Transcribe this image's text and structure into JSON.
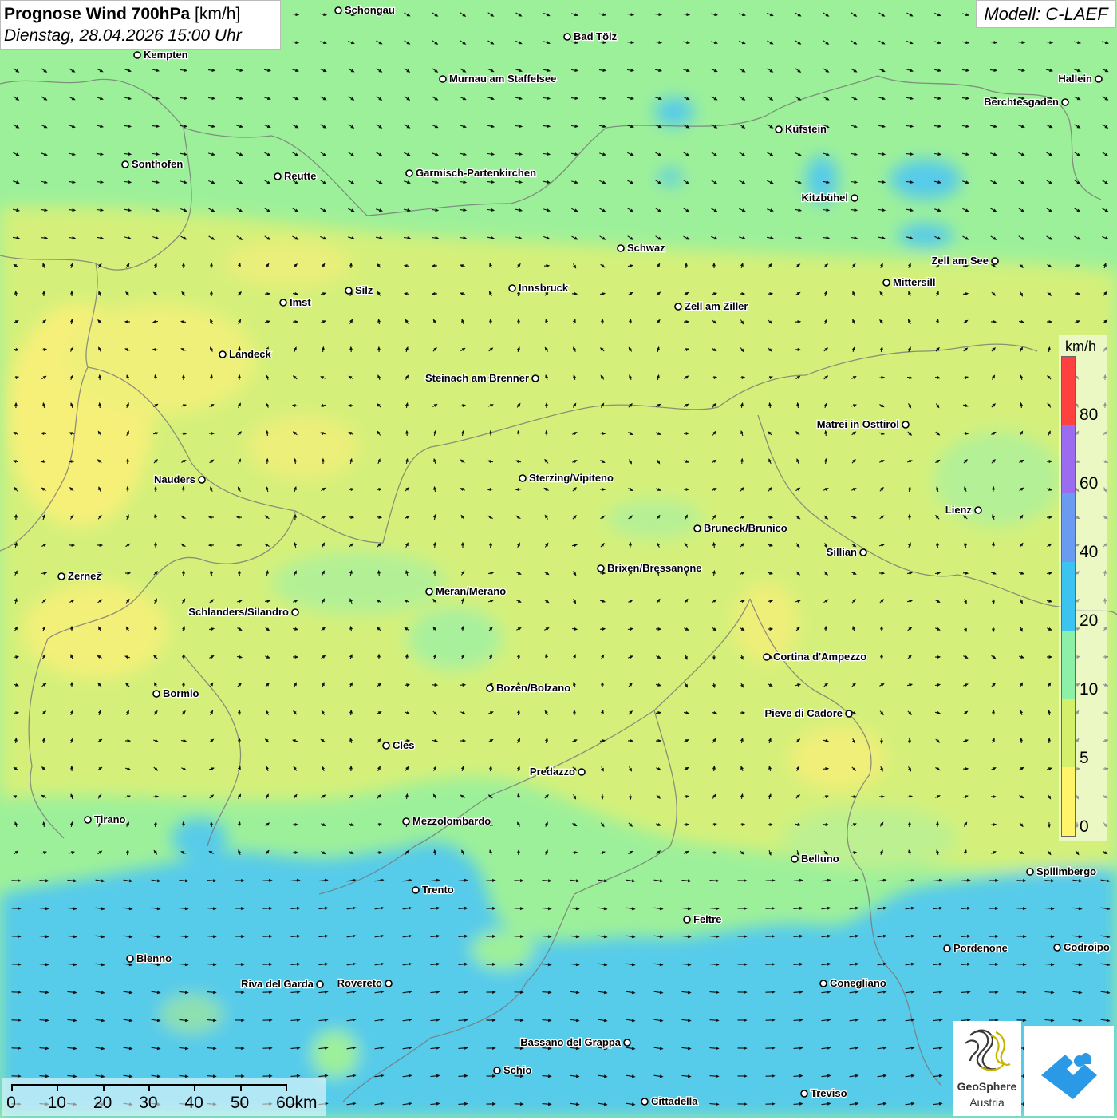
{
  "header": {
    "title_bold": "Prognose Wind 700hPa",
    "title_unit": "[km/h]",
    "datetime": "Dienstag, 28.04.2026 15:00 Uhr",
    "model": "Modell: C-LAEF"
  },
  "legend": {
    "unit": "km/h",
    "ticks": [
      "80",
      "60",
      "40",
      "20",
      "10",
      "5",
      "0"
    ],
    "colors": [
      "#ff4040",
      "#9b6cf0",
      "#6a9bf0",
      "#3cc3f0",
      "#8cf0a6",
      "#d2f06a",
      "#fff46a"
    ]
  },
  "scalebar": {
    "labels": [
      "0",
      "10",
      "20",
      "30",
      "40",
      "50",
      "60km"
    ]
  },
  "logo": {
    "name": "GeoSphere",
    "sub": "Austria"
  },
  "cities": [
    {
      "name": "Schongau"
    },
    {
      "name": "Bad Tölz"
    },
    {
      "name": "Kempten"
    },
    {
      "name": "Murnau am Staffelsee"
    },
    {
      "name": "Hallein"
    },
    {
      "name": "Berchtesgaden"
    },
    {
      "name": "Kufstein"
    },
    {
      "name": "Sonthofen"
    },
    {
      "name": "Reutte"
    },
    {
      "name": "Garmisch-Partenkirchen"
    },
    {
      "name": "Kitzbühel"
    },
    {
      "name": "Schwaz"
    },
    {
      "name": "Zell am See"
    },
    {
      "name": "Mittersill"
    },
    {
      "name": "Innsbruck"
    },
    {
      "name": "Silz"
    },
    {
      "name": "Imst"
    },
    {
      "name": "Zell am Ziller"
    },
    {
      "name": "Landeck"
    },
    {
      "name": "Steinach am Brenner"
    },
    {
      "name": "Matrei in Osttirol"
    },
    {
      "name": "Nauders"
    },
    {
      "name": "Sterzing/Vipiteno"
    },
    {
      "name": "Lienz"
    },
    {
      "name": "Bruneck/Brunico"
    },
    {
      "name": "Sillian"
    },
    {
      "name": "Brixen/Bressanone"
    },
    {
      "name": "Zernez"
    },
    {
      "name": "Meran/Merano"
    },
    {
      "name": "Schlanders/Silandro"
    },
    {
      "name": "Cortina d'Ampezzo"
    },
    {
      "name": "Bozen/Bolzano"
    },
    {
      "name": "Bormio"
    },
    {
      "name": "Pieve di Cadore"
    },
    {
      "name": "Cles"
    },
    {
      "name": "Predazzo"
    },
    {
      "name": "Tirano"
    },
    {
      "name": "Mezzolombardo"
    },
    {
      "name": "Belluno"
    },
    {
      "name": "Spilimbergo"
    },
    {
      "name": "Trento"
    },
    {
      "name": "Feltre"
    },
    {
      "name": "Pordenone"
    },
    {
      "name": "Codroipo"
    },
    {
      "name": "Bienno"
    },
    {
      "name": "Riva del Garda"
    },
    {
      "name": "Rovereto"
    },
    {
      "name": "Conegliano"
    },
    {
      "name": "Bassano del Grappa"
    },
    {
      "name": "Schio"
    },
    {
      "name": "Treviso"
    },
    {
      "name": "Cittadella"
    }
  ]
}
